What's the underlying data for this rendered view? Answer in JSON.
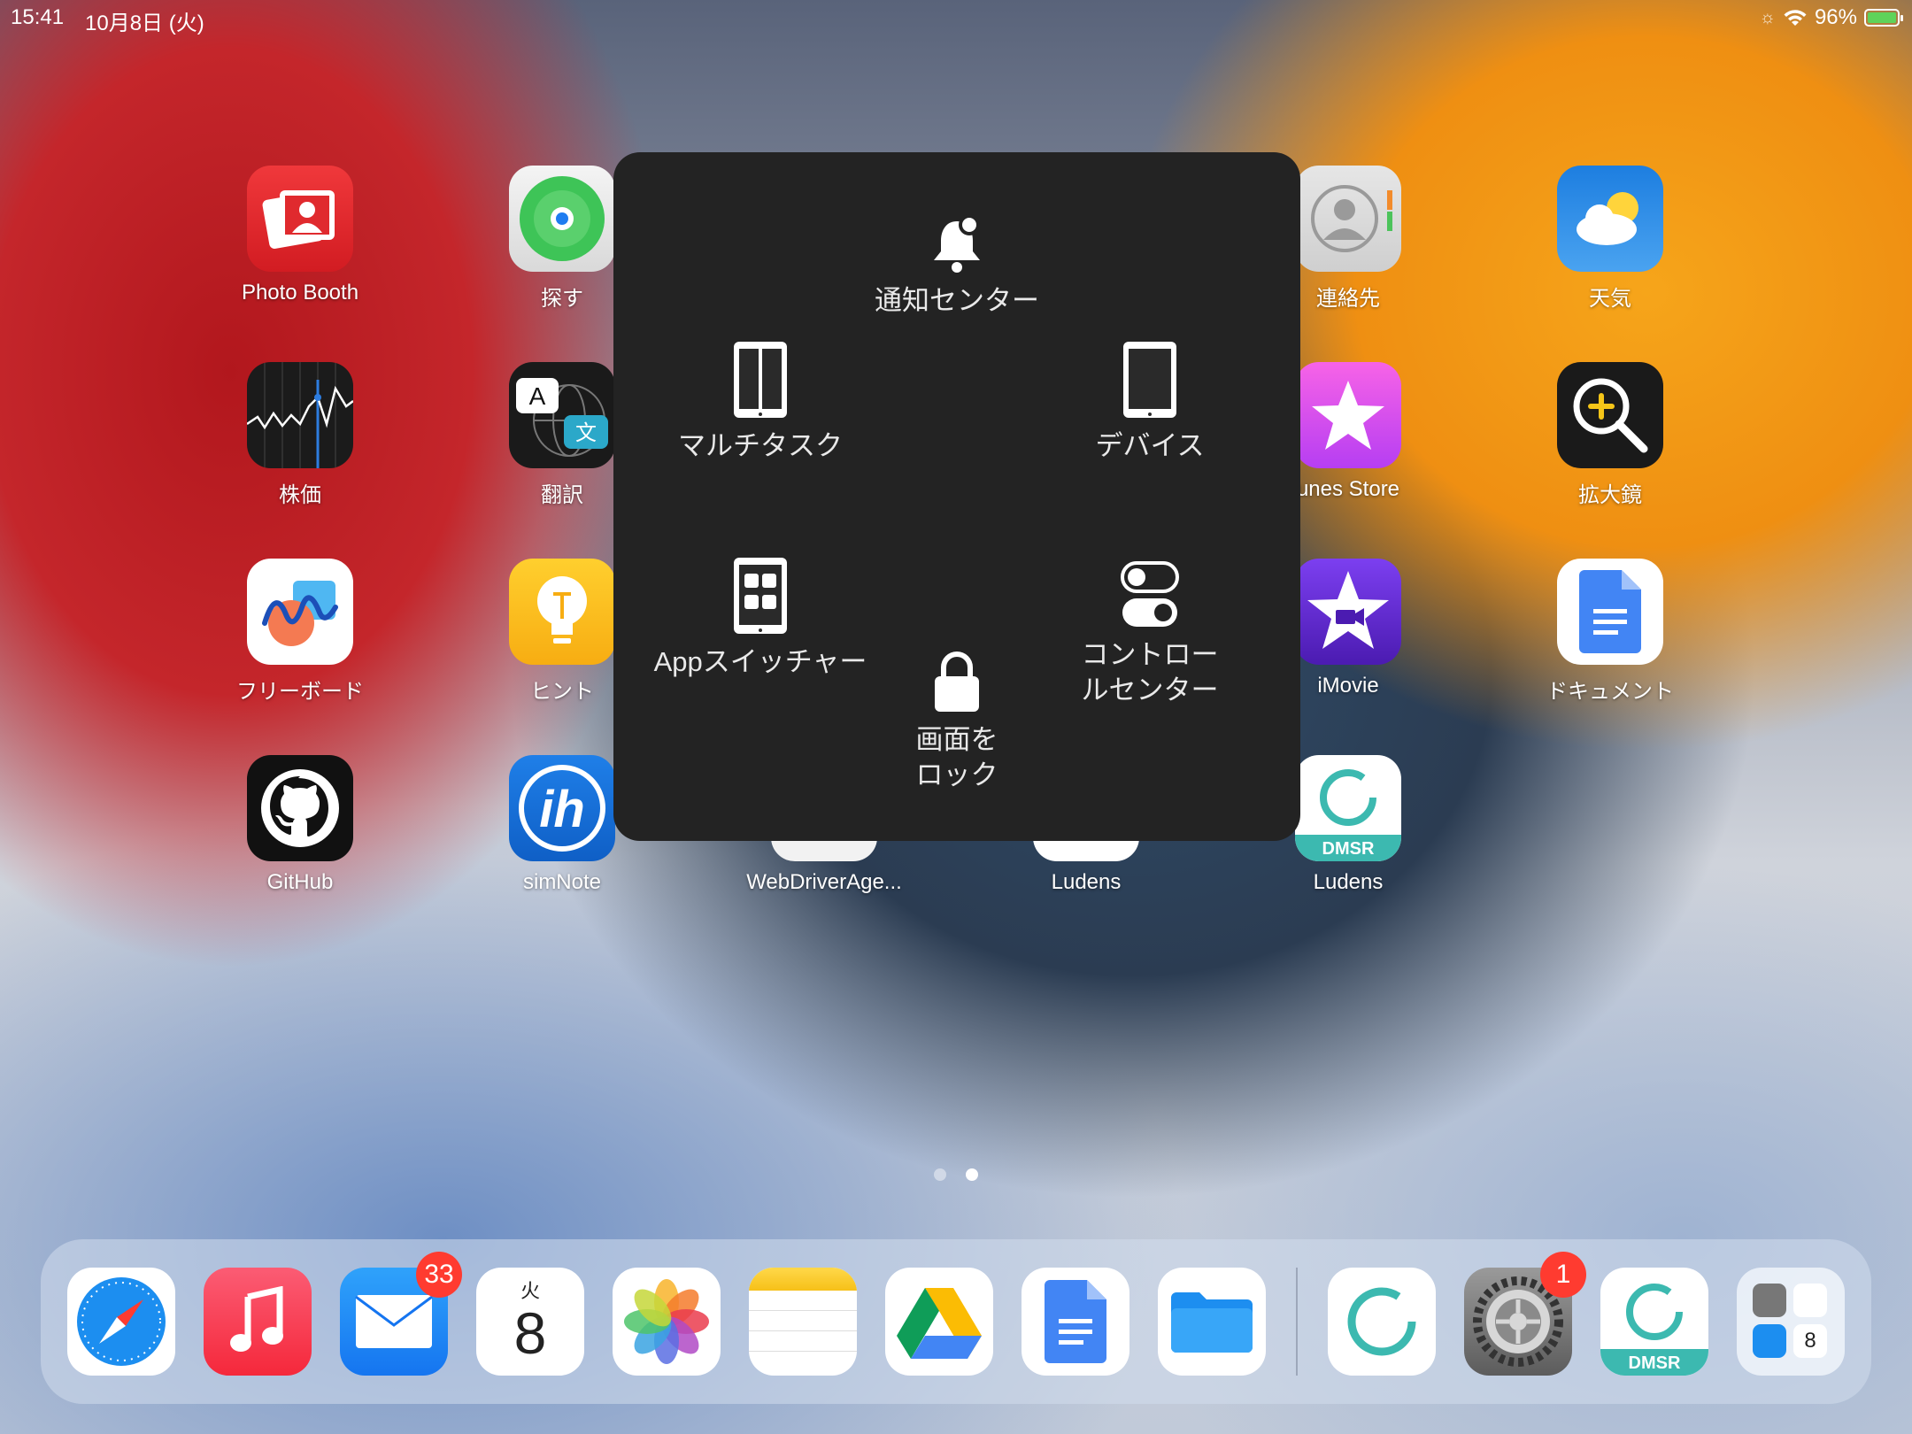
{
  "status_bar": {
    "time": "15:41",
    "date": "10月8日 (火)",
    "battery": "96%"
  },
  "apps": {
    "photo_booth": "Photo Booth",
    "find_my": "探す",
    "contacts": "連絡先",
    "weather": "天気",
    "stocks": "株価",
    "translate": "翻訳",
    "itunes_store": "unes Store",
    "magnifier": "拡大鏡",
    "freeform": "フリーボード",
    "tips": "ヒント",
    "imovie": "iMovie",
    "docs": "ドキュメント",
    "github": "GitHub",
    "simnote": "simNote",
    "webdriveragent": "WebDriverAge...",
    "ludens1": "Ludens",
    "ludens2": "Ludens"
  },
  "assistive_menu": {
    "notification_center": "通知センター",
    "multitask": "マルチタスク",
    "device": "デバイス",
    "app_switcher": "Appスイッチャー",
    "control_center_line1": "コントロー",
    "control_center_line2": "ルセンター",
    "lock_screen_line1": "画面を",
    "lock_screen_line2": "ロック"
  },
  "dock": {
    "mail_badge": "33",
    "calendar_weekday": "火",
    "calendar_day": "8",
    "settings_badge": "1",
    "dmsr_label": "DMSR",
    "folder_calendar_day": "8"
  },
  "ludens_dmsr_label": "DMSR",
  "colors": {
    "menu_bg": "#232323",
    "badge": "#ff3b30",
    "docs_blue": "#4285f4"
  },
  "page_indicator": {
    "pages": 2,
    "current": 2
  }
}
